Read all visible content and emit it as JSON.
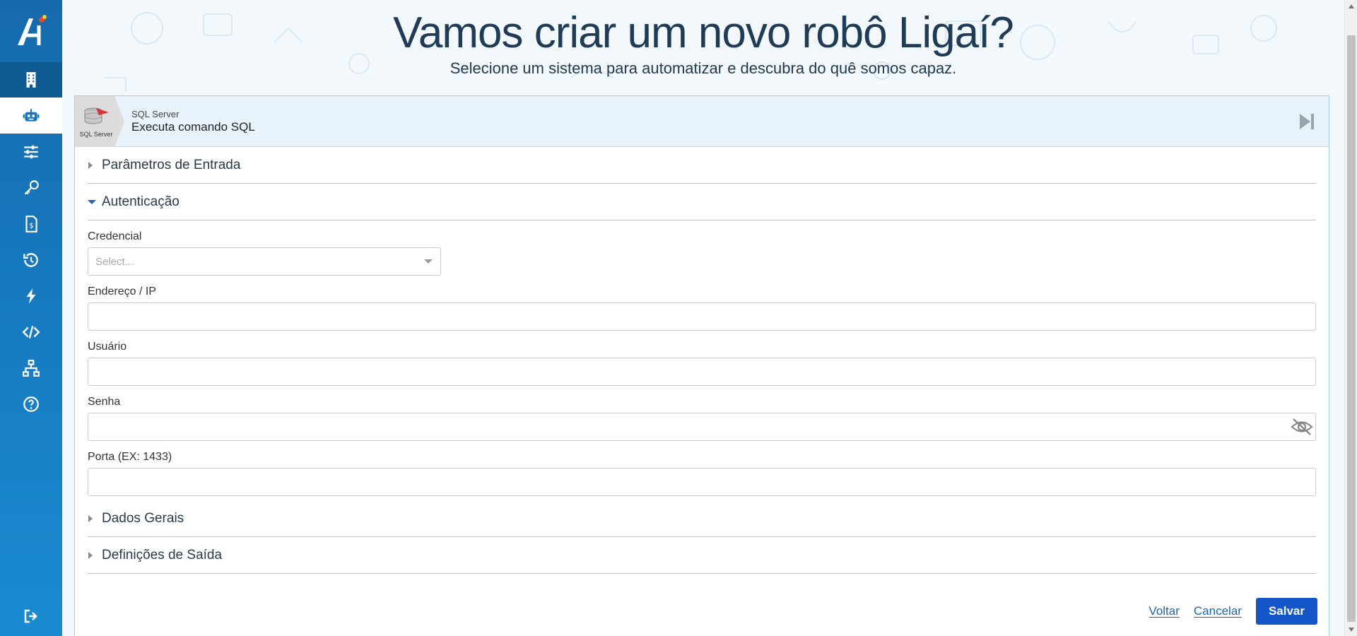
{
  "page": {
    "title": "Vamos criar um novo robô Ligaí?",
    "subtitle": "Selecione um sistema para automatizar e descubra do quê somos capaz."
  },
  "sidebar": {
    "items": [
      {
        "icon": "building-icon"
      },
      {
        "icon": "robot-icon"
      },
      {
        "icon": "sliders-icon"
      },
      {
        "icon": "key-icon"
      },
      {
        "icon": "invoice-icon"
      },
      {
        "icon": "history-icon"
      },
      {
        "icon": "bolt-icon"
      },
      {
        "icon": "code-icon"
      },
      {
        "icon": "network-icon"
      },
      {
        "icon": "help-icon"
      }
    ],
    "bottom_icon": "logout-icon"
  },
  "card": {
    "system_logo_label": "SQL Server",
    "system_name": "SQL Server",
    "action": "Executa comando SQL"
  },
  "sections": {
    "entrada": "Parâmetros de Entrada",
    "autenticacao": "Autenticação",
    "dados_gerais": "Dados Gerais",
    "saida": "Definições de Saída"
  },
  "form": {
    "credencial_label": "Credencial",
    "credencial_placeholder": "Select...",
    "endereco_label": "Endereço / IP",
    "endereco_value": "",
    "usuario_label": "Usuário",
    "usuario_value": "",
    "senha_label": "Senha",
    "senha_value": "",
    "porta_label": "Porta (EX: 1433)",
    "porta_value": ""
  },
  "footer": {
    "voltar": "Voltar",
    "cancelar": "Cancelar",
    "salvar": "Salvar"
  },
  "colors": {
    "sidebar": "#1677bd",
    "primary_button": "#1456c8",
    "link": "#1a67b5"
  }
}
